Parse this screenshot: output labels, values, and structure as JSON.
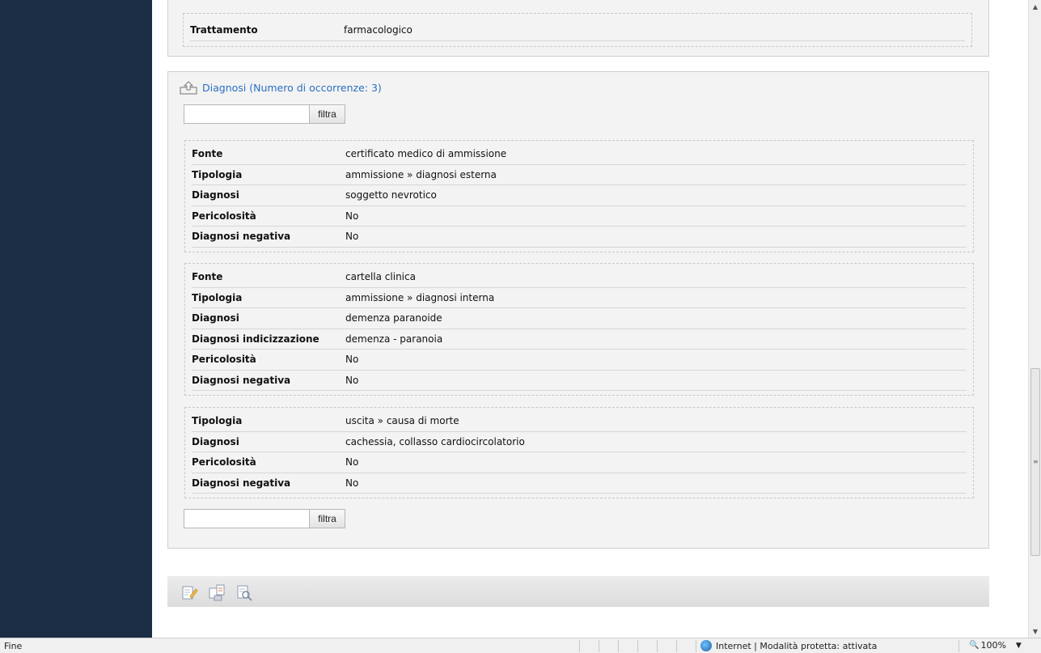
{
  "top_record": {
    "rows": [
      {
        "label": "Trattamento",
        "value": "farmacologico"
      }
    ]
  },
  "diagnosi": {
    "title": "Diagnosi (Numero di occorrenze: 3)",
    "filter_button": "filtra",
    "filter_placeholder": "",
    "records": [
      {
        "rows": [
          {
            "label": "Fonte",
            "value": "certificato medico di ammissione"
          },
          {
            "label": "Tipologia",
            "value": "ammissione » diagnosi esterna"
          },
          {
            "label": "Diagnosi",
            "value": "soggetto nevrotico"
          },
          {
            "label": "Pericolosità",
            "value": "No"
          },
          {
            "label": "Diagnosi negativa",
            "value": "No"
          }
        ]
      },
      {
        "rows": [
          {
            "label": "Fonte",
            "value": "cartella clinica"
          },
          {
            "label": "Tipologia",
            "value": "ammissione » diagnosi interna"
          },
          {
            "label": "Diagnosi",
            "value": "demenza paranoide"
          },
          {
            "label": "Diagnosi indicizzazione",
            "value": "demenza - paranoia"
          },
          {
            "label": "Pericolosità",
            "value": "No"
          },
          {
            "label": "Diagnosi negativa",
            "value": "No"
          }
        ]
      },
      {
        "rows": [
          {
            "label": "Tipologia",
            "value": "uscita » causa di morte"
          },
          {
            "label": "Diagnosi",
            "value": "cachessia, collasso cardiocircolatorio"
          },
          {
            "label": "Pericolosità",
            "value": "No"
          },
          {
            "label": "Diagnosi negativa",
            "value": "No"
          }
        ]
      }
    ]
  },
  "action_bar": {
    "icons": [
      "edit-icon",
      "export-icon",
      "preview-icon"
    ]
  },
  "statusbar": {
    "status": "Fine",
    "zone": "Internet | Modalità protetta: attivata",
    "zoom": "100%"
  }
}
